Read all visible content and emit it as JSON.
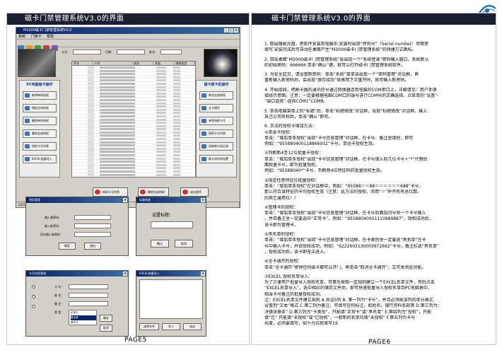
{
  "left_page": {
    "title": "磁卡门禁管理系统V3.0的界面",
    "page_label": "PAGE5",
    "main_window": {
      "title": "M2000磁卡门禁管理系统V3.0",
      "menu": [
        "系统",
        "门禁卡",
        "帮助"
      ],
      "search_fields": [
        "卡号：",
        "日期：",
        "姓名："
      ],
      "columns": [
        "序号",
        "卡号",
        "姓名",
        "状态",
        "授权类型"
      ],
      "left_panel_title": "PC电脑端卡操作",
      "left_buttons": [
        "新增单条授权",
        "增加全体授权",
        "删除单条授权",
        "删除全部授权",
        "授权卡号列表",
        "EXCEL批量导入"
      ],
      "right_panel_title": "磁卡刷卡机操作",
      "right_buttons": [
        "取消全部授权",
        "全卡通开",
        "单条授权卡号",
        "授权卡号列表",
        "读取刷卡机记录",
        "刷卡机时间设置"
      ],
      "bottom_buttons": [
        "授权卡号信息",
        "删除全部授权",
        "退出程序"
      ],
      "status": [
        "2011年6月11日",
        "16:27",
        "数据库记录",
        "版本:V3.0"
      ]
    },
    "login_dialog": {
      "title": "密码管理",
      "labels": [
        "输入原密码：",
        "输入新密码：",
        "再次输入新密码："
      ],
      "ok": "确定",
      "cancel": "退出"
    },
    "label_dialog": {
      "title": "标题修改",
      "label": "设置标题：",
      "ok": "确认",
      "cancel": "取消"
    },
    "card_dialog": {
      "title": "卡号信息管理",
      "labels": [
        "卡 号：",
        "姓 名：",
        "备 注：",
        "类 型："
      ],
      "options": [
        "正常卡",
        "黑名单",
        "单次卡"
      ],
      "selected": "黑名单",
      "ok": "确定",
      "cancel": "取消"
    },
    "excel_dialog": {
      "title": "EXCEL批量导入",
      "buttons": [
        "选择文件",
        "导入",
        "退出"
      ]
    }
  },
  "right_page": {
    "title": "磁卡门禁管理系统V3.0的界面",
    "page_label": "PAGE6",
    "lines": [
      "1. 取出随配光盘，把软件安装到电脑中,安装时出现“序列号”（Serial number）可随意",
      "填写.安装完成后可自动在桌面产生“M2000磁卡门禁管理系统”的快捷方式图标。",
      "",
      "2. 双击桌面“M2000磁卡门禁管理系统”会出现一个“系统登录”密码输入窗口，系统默认",
      "的初始密码：666666  单击“确认”键，就可以打开磁卡门禁管理系统软件。",
      "",
      "3. 为安全起见，请设置新密码：单击“系统”菜单会出现一个“密码管理”对话框，再",
      "重新输入新密码后，会出现“保存成功”就表明下次重开时，就可输入新密码。",
      "",
      "4. 开始接线，把刷卡器的通讯信号通过转换器连到电脑的COM串口上，详细请见：用户手册",
      "接线示意图。注意：一定要根据电脑COM口的端号进行COM号的正确选择。点菜单的“设置”-",
      "“端口选择”-选择COM1”COM8。",
      "",
      "5. 单击电脑菜单上的“标题”后，单击“标题修改”对话框，出现“标题修改”对话框，输入",
      "自己公司名称后，单击“确认”即可。",
      "",
      "6. 合法的授权卡增加方法：",
      "  ①单张卡授权：",
      "单击：“增加单条授权”出现“卡号信息管理”对话框，在卡号、备注里填好，即可",
      "例如：“955880400118866932”卡号，单张卡授权生效。",
      "",
      "  ②列断新4至12位批量卡授权：",
      "单击：“增加单条授权”出现“卡号信息管理”对话框，在卡号填入前几位卡号+“*”代替后",
      "面批量卡号，即为批量授权。",
      "例如：“95588040*”卡号，列断新4位特征码的批量授权生效。",
      "",
      "  ③指定任意特征位批量授权：",
      "单击：“增加单条授权”在对话框中，例如：“95588＝＝88＝＝＝＝＝＝688”卡号，",
      "那么符合该特征的卡均授权生效（注意：此方法的授权，须用“＝”补齐所有总位数，",
      "的其它通用位！）",
      "",
      "  ④管理卡的授权：",
      "单击：“增加单条授权”出现“卡号信息管理”对话框，在卡号后面加问号例一个卡号输入",
      "，并且备注里一定要选中“正常卡”，例如：“955880400011109898​87”，授权成功后，",
      "该卡即为管理卡。",
      "",
      "  ⑤黑名单的授权：",
      "单击：“增加单条授权”出现“卡号信息管理”对话框，在卡类别里一定要选“黑名单”在卡",
      "号中输入卡号，并说授权成功，例如：“622260313000397​2692”卡号，备注栏选“黑名单”",
      "，授权成功后，该卡即无法进入。",
      "",
      "  ⑥全卡通开的授权：",
      "单击“全卡通开”使得任何磁卡都可以开门，再单击“取消全卡通开”，又可关闭此功能。",
      "",
      "  ⑦EXCEL 授权名单导入：",
      "为了方便用户批量导入授权名单，可事先按照一定规则建立一个EXCEL名单文件，然后点击",
      "“EXCEL名单导入”，选中相应的储存文件后，即可快速批量导入授权名单到PC电脑表中，",
      "相当卡号备注的批量授权成功。",
      "注：EXCEL名单文件建立规则 A 共设5列 B. 第一列为“卡号”，并且必须能该列的单元格式",
      "设置到“文本”格式 C.第二列为备注，可填写任何标注，如姓名，银行资料条款等 D.第三列为：",
      "决德张振条“ D.第三列为“卡类别”，只能填“正常卡”或“黑名单” E.第四列为“授权”，只能",
      "填“已”  只能填“未授权”或“已授权”，一般新的名单均填“未授权” F.第五列为卡号",
      "长度，必须要填写，如十九位就填写19"
    ]
  }
}
